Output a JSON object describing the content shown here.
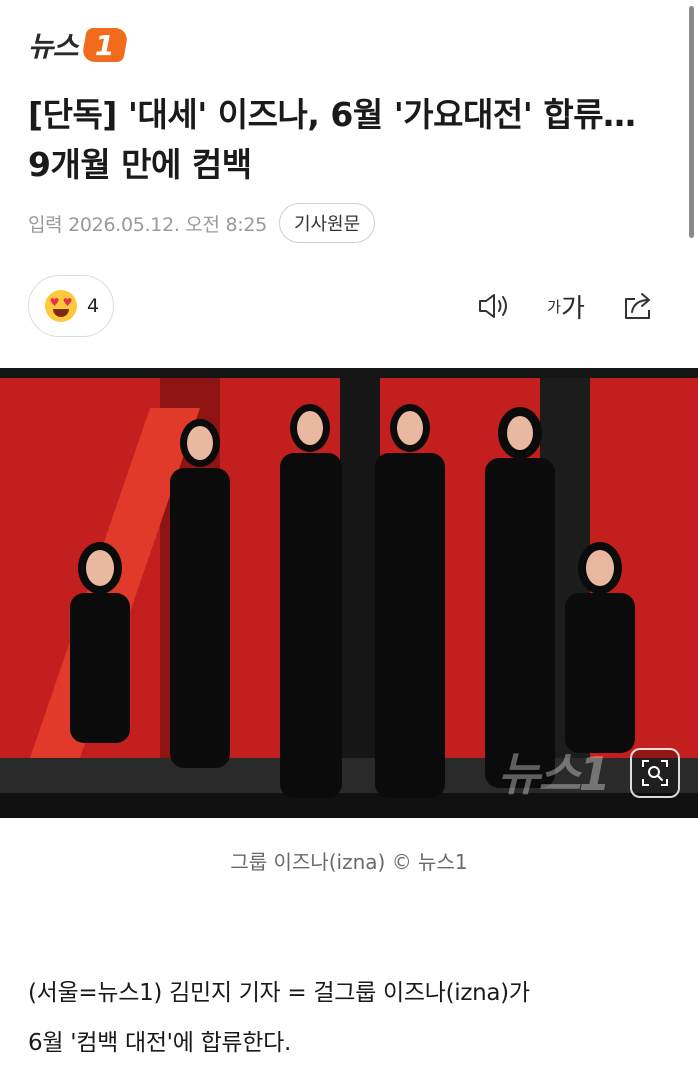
{
  "logo": {
    "text": "뉴스",
    "badge": "1",
    "accent": "#f26b1d"
  },
  "article": {
    "headline": "[단독] '대세' 이즈나, 6월 '가요대전' 합류…9개월 만에 컴백",
    "date": "입력 2026.05.12. 오전 8:25",
    "original_button": "기사원문",
    "reaction": {
      "icon": "heart-eyes-emoji-icon",
      "count": "4"
    },
    "toolbar": {
      "audio_icon": "speaker-icon",
      "font_small": "가",
      "font_big": "가",
      "share_icon": "share-icon"
    },
    "photo": {
      "watermark": "뉴스1",
      "caption": "그룹 이즈나(izna) © 뉴스1",
      "zoom_icon": "zoom-icon"
    },
    "body_lines": [
      "(서울=뉴스1) 김민지 기자 = 걸그룹 이즈나(izna)가",
      "6월 '컴백 대전'에 합류한다."
    ]
  }
}
